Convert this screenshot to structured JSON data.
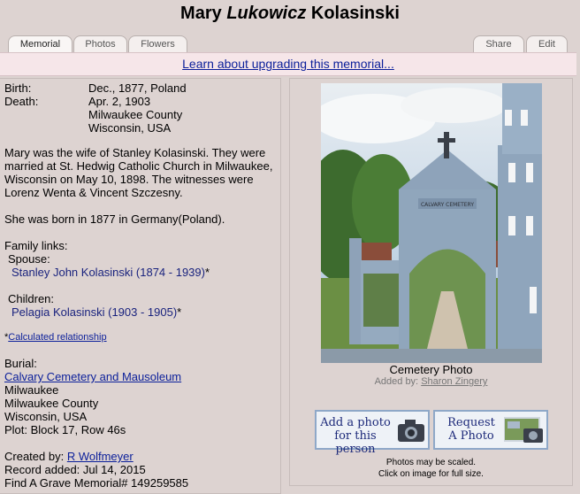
{
  "header": {
    "first_name": "Mary",
    "middle_name": "Lukowicz",
    "last_name": "Kolasinski"
  },
  "tabs": [
    {
      "label": "Memorial",
      "active": true
    },
    {
      "label": "Photos",
      "active": false
    },
    {
      "label": "Flowers",
      "active": false
    },
    {
      "label": "Share",
      "active": false
    },
    {
      "label": "Edit",
      "active": false
    }
  ],
  "upgrade": {
    "link_text": "Learn about upgrading this memorial..."
  },
  "vitals": {
    "birth_label": "Birth:",
    "birth_value": "Dec., 1877, Poland",
    "death_label": "Death:",
    "death_value": "Apr. 2, 1903",
    "death_county": "Milwaukee County",
    "death_state": "Wisconsin, USA"
  },
  "bio": {
    "paragraph1": "Mary was the wife of Stanley Kolasinski. They were married at St. Hedwig Catholic Church in Milwaukee, Wisconsin on May 10, 1898. The witnesses were Lorenz Wenta & Vincent Szczesny.",
    "paragraph2": "She was born in 1877 in Germany(Poland)."
  },
  "family": {
    "heading": "Family links:",
    "spouse_label": "Spouse:",
    "spouse_link": "Stanley John Kolasinski (1874 - 1939)",
    "spouse_suffix": "*",
    "children_label": "Children:",
    "child_link": "Pelagia Kolasinski (1903 - 1905)",
    "child_suffix": "*",
    "calc_prefix": "*",
    "calc_link": "Calculated relationship"
  },
  "burial": {
    "label": "Burial:",
    "cemetery_link": "Calvary Cemetery and Mausoleum",
    "city": "Milwaukee",
    "county": "Milwaukee County",
    "state": "Wisconsin, USA",
    "plot": "Plot: Block 17, Row 46s"
  },
  "record": {
    "created_label": "Created by:",
    "created_by": "R Wolfmeyer",
    "added": "Record added: Jul 14, 2015",
    "memorial_id": "Find A Grave Memorial# 149259585"
  },
  "photo": {
    "caption": "Cemetery Photo",
    "added_by_label": "Added by:",
    "added_by": "Sharon Zingery",
    "sign_text": "CALVARY CEMETERY"
  },
  "buttons": {
    "add_photo_line1": "Add a photo",
    "add_photo_line2": "for this person",
    "request_line1": "Request",
    "request_line2": "A Photo"
  },
  "notes": {
    "line1": "Photos may be scaled.",
    "line2": "Click on image for full size."
  },
  "colors": {
    "background": "#ddd3d1",
    "link": "#0b1f9a",
    "upgrade_bar": "#f6e6e9",
    "button_border": "#8ea8c8"
  }
}
